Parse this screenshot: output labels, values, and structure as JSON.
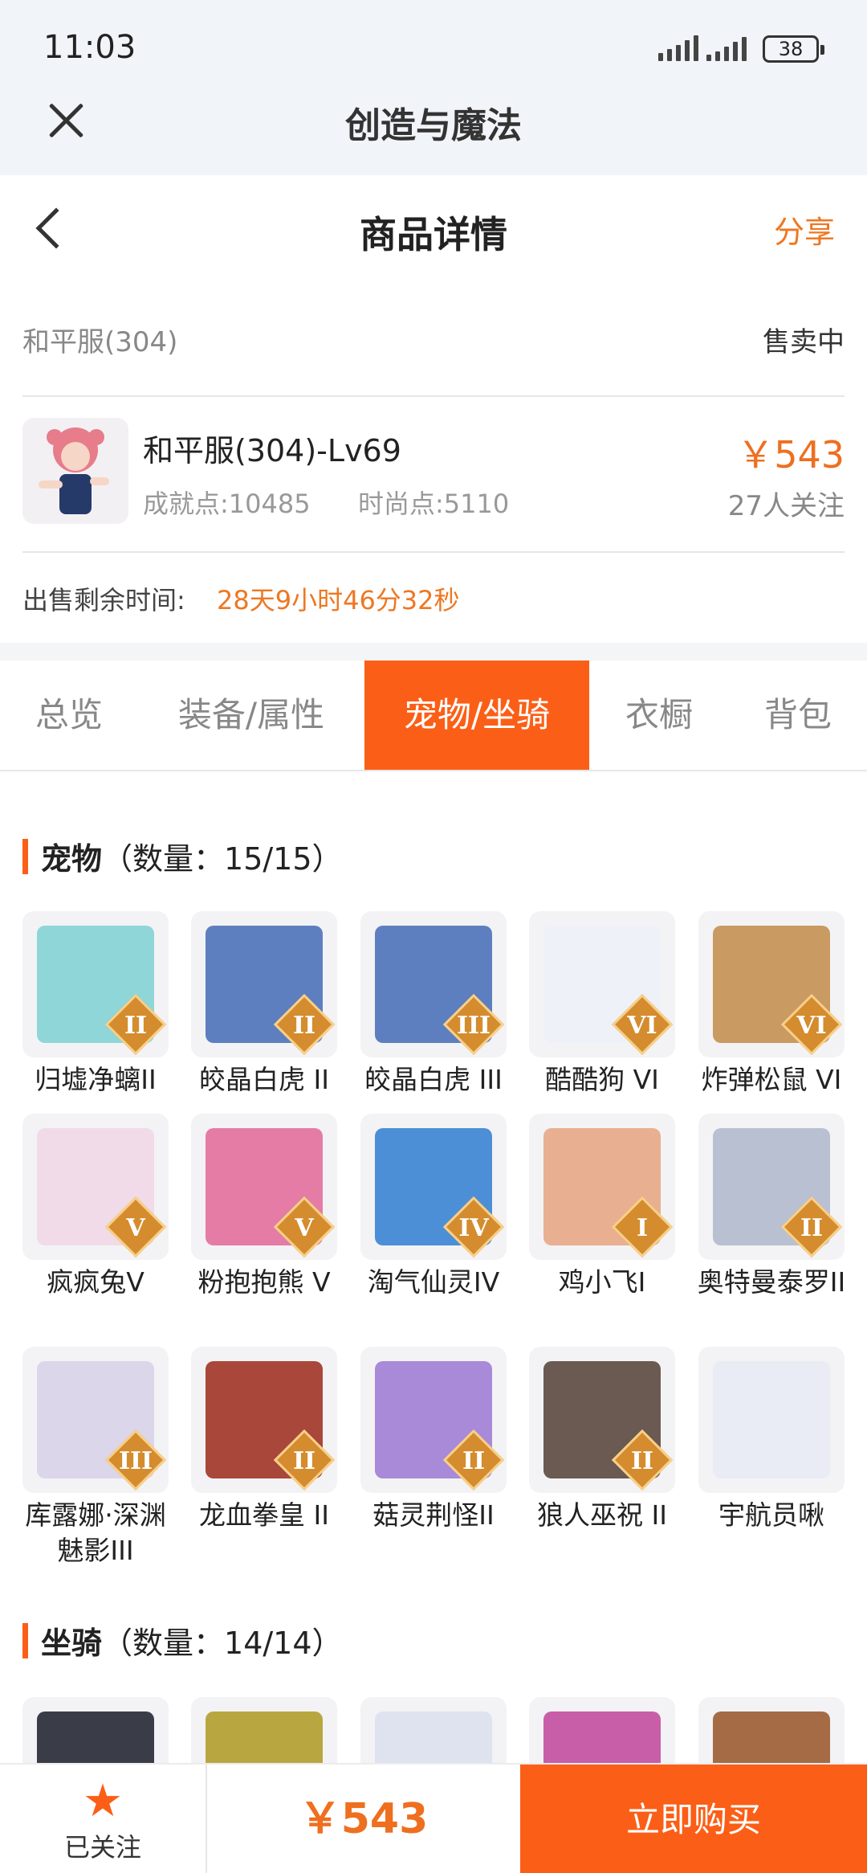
{
  "status": {
    "time": "11:03",
    "battery": "38"
  },
  "app": {
    "title": "创造与魔法"
  },
  "nav": {
    "title": "商品详情",
    "share": "分享"
  },
  "server": {
    "name": "和平服(304)",
    "status": "售卖中"
  },
  "product": {
    "title": "和平服(304)-Lv69",
    "achievement": "成就点:10485",
    "fashion": "时尚点:5110",
    "price": "￥543",
    "followers": "27人关注"
  },
  "remaining": {
    "label": "出售剩余时间:",
    "value": "28天9小时46分32秒"
  },
  "tabs": [
    {
      "label": "总览",
      "active": false
    },
    {
      "label": "装备/属性",
      "active": false
    },
    {
      "label": "宠物/坐骑",
      "active": true
    },
    {
      "label": "衣橱",
      "active": false
    },
    {
      "label": "背包",
      "active": false
    }
  ],
  "pets": {
    "heading": "宠物",
    "count": "（数量：15/15）",
    "items": [
      {
        "name": "归墟净螭II",
        "badge": "II",
        "color": "#8fd6d8"
      },
      {
        "name": "皎晶白虎 II",
        "badge": "II",
        "color": "#5e7fbf"
      },
      {
        "name": "皎晶白虎 III",
        "badge": "III",
        "color": "#5e7fbf"
      },
      {
        "name": "酷酷狗 VI",
        "badge": "VI",
        "color": "#eef2f8"
      },
      {
        "name": "炸弹松鼠 VI",
        "badge": "VI",
        "color": "#c99a62"
      },
      {
        "name": "疯疯兔V",
        "badge": "V",
        "color": "#f1dbe8"
      },
      {
        "name": "粉抱抱熊 V",
        "badge": "V",
        "color": "#e57ca6"
      },
      {
        "name": "淘气仙灵IV",
        "badge": "IV",
        "color": "#4d8fd6"
      },
      {
        "name": "鸡小飞I",
        "badge": "I",
        "color": "#e8b091"
      },
      {
        "name": "奥特曼泰罗II",
        "badge": "II",
        "color": "#b9c0d2"
      },
      {
        "name": "库露娜·深渊魅影III",
        "badge": "III",
        "color": "#dcd6ea"
      },
      {
        "name": "龙血拳皇 II",
        "badge": "II",
        "color": "#a9473a"
      },
      {
        "name": "菇灵荆怪II",
        "badge": "II",
        "color": "#a88ad8"
      },
      {
        "name": "狼人巫祝 II",
        "badge": "II",
        "color": "#6b5a52"
      },
      {
        "name": "宇航员啾",
        "badge": "",
        "color": "#e9ecf4"
      }
    ]
  },
  "mounts": {
    "heading": "坐骑",
    "count": "（数量：14/14）",
    "colors": [
      "#3a3d47",
      "#b8a740",
      "#dfe3f0",
      "#c95ea8",
      "#a56b45"
    ]
  },
  "bottom": {
    "favorite": "已关注",
    "price": "￥543",
    "buy": "立即购买"
  },
  "icons": [
    "close-icon",
    "back-icon",
    "star-icon"
  ]
}
